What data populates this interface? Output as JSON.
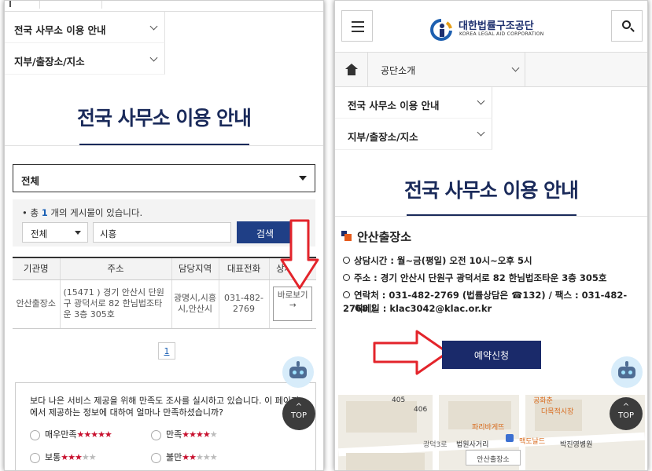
{
  "left": {
    "dropdowns": [
      {
        "label": "전국 사무소 이용 안내"
      },
      {
        "label": "지부/출장소/지소"
      }
    ],
    "page_title": "전국 사무소 이용 안내",
    "region_select": "전체",
    "count_prefix": "• 총 ",
    "count_value": "1",
    "count_suffix": " 개의 게시물이 있습니다.",
    "search_scope": "전체",
    "search_keyword": "시흥",
    "search_button": "검색",
    "table": {
      "headers": [
        "기관명",
        "주소",
        "담당지역",
        "대표전화",
        "상세안내"
      ],
      "rows": [
        {
          "name": "안산출장소",
          "address": "(15471 ) 경기 안산시 단원구 광덕서로 82 한님법조타운 3층 305호",
          "area": "광명시,시흥시,안산시",
          "phone": "031-482-2769",
          "detail_label": "바로보기",
          "detail_arrow": "→"
        }
      ]
    },
    "pager": [
      "1"
    ],
    "survey": {
      "question": "보다 나은 서비스 제공을 위해 만족도 조사를 실시하고 있습니다. 이 페이지에서 제공하는 정보에 대하여 얼마나 만족하셨습니까?",
      "options": [
        {
          "label": "매우만족",
          "stars": 5
        },
        {
          "label": "만족",
          "stars": 4
        },
        {
          "label": "보통",
          "stars": 3
        },
        {
          "label": "불만",
          "stars": 2
        }
      ]
    },
    "top_button": "TOP",
    "top_caret": "^"
  },
  "right": {
    "logo_text": "대한법률구조공단",
    "logo_sub": "KOREA LEGAL AID CORPORATION",
    "nav_item": "공단소개",
    "dropdowns": [
      {
        "label": "전국 사무소 이용 안내"
      },
      {
        "label": "지부/출장소/지소"
      }
    ],
    "page_title": "전국 사무소 이용 안내",
    "office_name": "안산출장소",
    "info": [
      "상담시간 : 월~금(평일) 오전 10시~오후 5시",
      "주소 : 경기 안산시 단원구 광덕서로 82 한님법조타운 3층 305호",
      "연락처 : 031-482-2769 (법률상담은 ☎132) / 팩스 : 031-482-2768 /",
      "이메일 : klac3042@klac.or.kr"
    ],
    "reserve_button": "예약신청",
    "map_labels": [
      "405",
      "406",
      "공화춘",
      "다목적시장",
      "파리바게뜨",
      "광덕3로",
      "법원사거리",
      "맥도날드",
      "박진영병원",
      "안산출장소"
    ],
    "top_button": "TOP",
    "top_caret": "^"
  },
  "colors": {
    "navy": "#1a2a5a",
    "button_navy": "#1f3f86",
    "accent_blue": "#1a5fb4",
    "star_red": "#c8102e",
    "arrow_red": "#e3242b"
  },
  "icons": [
    "menu-icon",
    "search-icon",
    "home-icon",
    "chevron-down-icon",
    "chatbot-icon",
    "klac-logo-icon"
  ]
}
